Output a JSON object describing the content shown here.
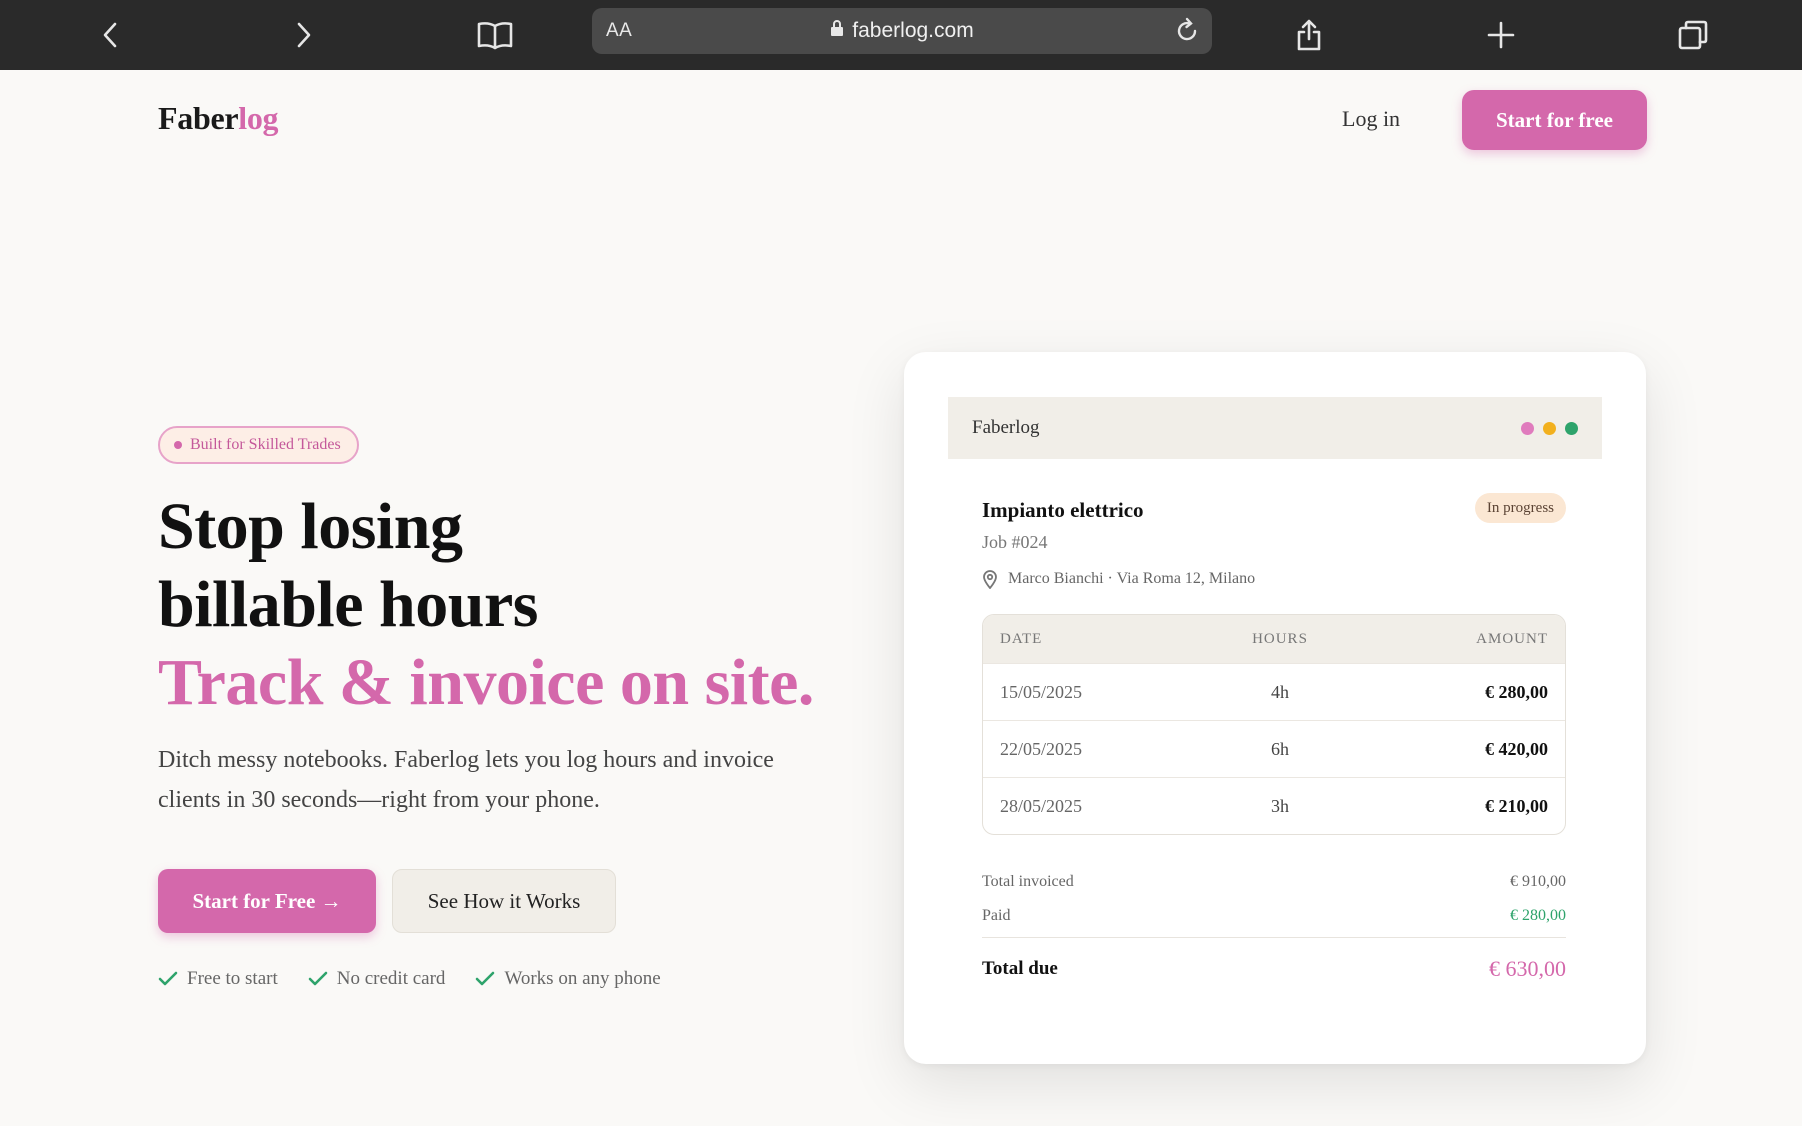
{
  "browser": {
    "text_size_label": "AA",
    "url": "faberlog.com"
  },
  "nav": {
    "logo_main": "Faber",
    "logo_accent": "log",
    "login_label": "Log in",
    "cta_label": "Start for free"
  },
  "hero": {
    "badge": "Built for Skilled Trades",
    "headline_line1": "Stop losing",
    "headline_line2": "billable hours",
    "headline_line3": "Track & invoice on site.",
    "lead_line1": "Ditch messy notebooks. Faberlog lets you log hours and invoice",
    "lead_line2": "clients in 30 seconds—right from your phone.",
    "primary_button": "Start for Free →",
    "secondary_button": "See How it Works",
    "checks": [
      "Free to start",
      "No credit card",
      "Works on any phone"
    ]
  },
  "card": {
    "app_title": "Faberlog",
    "window_dot_colors": [
      "#e07bbd",
      "#f2b01e",
      "#2ea36b"
    ],
    "job_title": "Impianto elettrico",
    "job_number": "Job #024",
    "status": "In progress",
    "client_line": "Marco Bianchi · Via Roma 12, Milano",
    "table": {
      "headers": [
        "DATE",
        "HOURS",
        "AMOUNT"
      ],
      "rows": [
        {
          "date": "15/05/2025",
          "hours": "4h",
          "amount": "€ 280,00"
        },
        {
          "date": "22/05/2025",
          "hours": "6h",
          "amount": "€ 420,00"
        },
        {
          "date": "28/05/2025",
          "hours": "3h",
          "amount": "€ 210,00"
        }
      ]
    },
    "summary": {
      "invoiced_label": "Total invoiced",
      "invoiced_value": "€ 910,00",
      "paid_label": "Paid",
      "paid_value": "€ 280,00",
      "due_label": "Total due",
      "due_value": "€ 630,00"
    }
  },
  "colors": {
    "accent": "#d468ab",
    "success": "#2ea36b"
  }
}
